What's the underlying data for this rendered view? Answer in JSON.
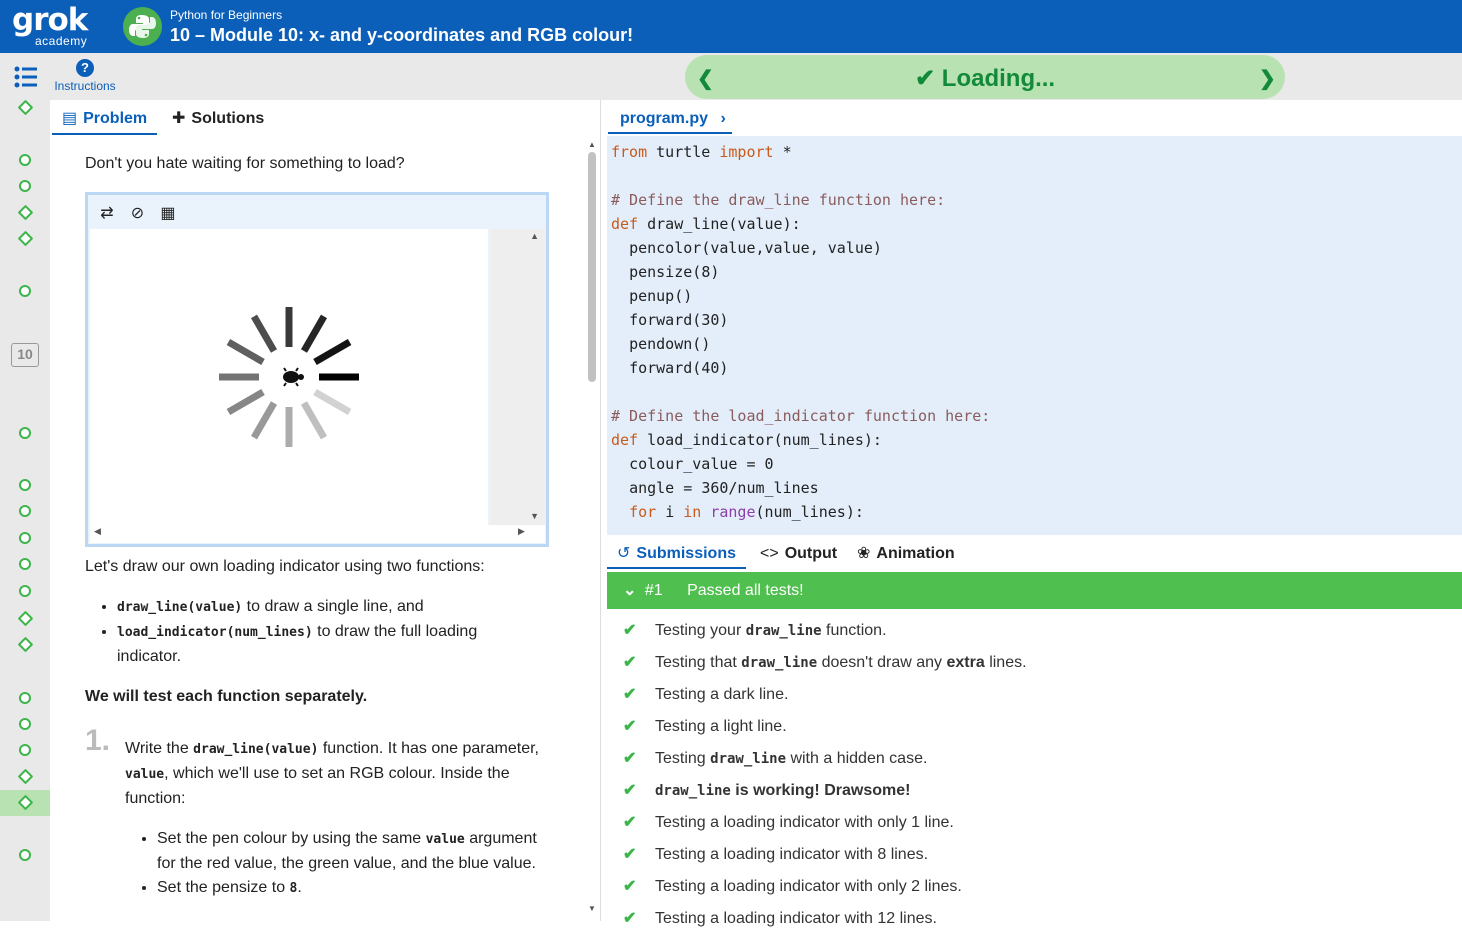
{
  "header": {
    "logo_main": "grok",
    "logo_sub": "academy",
    "course_name": "Python for Beginners",
    "module_title": "10 – Module 10: x- and y-coordinates and RGB colour!"
  },
  "toolbar": {
    "instructions_label": "Instructions",
    "loading_text": "Loading...",
    "module_badge": "10"
  },
  "left_tabs": {
    "problem": "Problem",
    "solutions": "Solutions"
  },
  "problem": {
    "intro": "Don't you hate waiting for something to load?",
    "lets_draw": "Let's draw our own loading indicator using two functions:",
    "bullet1_code": "draw_line(value)",
    "bullet1_text": " to draw a single line, and",
    "bullet2_code": "load_indicator(num_lines)",
    "bullet2_text": " to draw the full loading indicator.",
    "test_note": "We will test each function separately.",
    "step_number": "1.",
    "step1_a": "Write the ",
    "step1_code": "draw_line(value)",
    "step1_b": " function. It has one parameter, ",
    "step1_code2": "value",
    "step1_c": ", which we'll use to set an RGB colour. Inside the function:",
    "sub1_a": "Set the pen colour by using the same ",
    "sub1_code": "value",
    "sub1_b": " argument for the red value, the green value, and the blue value.",
    "sub2_a": "Set the pensize to ",
    "sub2_code": "8",
    "sub2_b": "."
  },
  "editor": {
    "file_tab": "program.py",
    "code": [
      "from turtle import *",
      "",
      "# Define the draw_line function here:",
      "def draw_line(value):",
      "  pencolor(value,value, value)",
      "  pensize(8)",
      "  penup()",
      "  forward(30)",
      "  pendown()",
      "  forward(40)",
      "",
      "# Define the load_indicator function here:",
      "def load_indicator(num_lines):",
      "  colour_value = 0",
      "  angle = 360/num_lines",
      "  for i in range(num_lines):"
    ]
  },
  "results_tabs": {
    "submissions": "Submissions",
    "output": "Output",
    "animation": "Animation"
  },
  "submission": {
    "number": "#1",
    "status": "Passed all tests!"
  },
  "tests": [
    {
      "a": "Testing your ",
      "code": "draw_line",
      "b": " function.",
      "bold": false
    },
    {
      "a": "Testing that ",
      "code": "draw_line",
      "b": " doesn't draw any ",
      "strong": "extra",
      "c": " lines.",
      "bold": false
    },
    {
      "a": "Testing a dark line.",
      "bold": false
    },
    {
      "a": "Testing a light line.",
      "bold": false
    },
    {
      "a": "Testing ",
      "code": "draw_line",
      "b": " with a hidden case.",
      "bold": false
    },
    {
      "a": "",
      "code": "draw_line",
      "b": " is working! Drawsome!",
      "bold": true
    },
    {
      "a": "Testing a loading indicator with only 1 line.",
      "bold": false
    },
    {
      "a": "Testing a loading indicator with 8 lines.",
      "bold": false
    },
    {
      "a": "Testing a loading indicator with only 2 lines.",
      "bold": false
    },
    {
      "a": "Testing a loading indicator with 12 lines.",
      "bold": false
    }
  ],
  "colors": {
    "brand_blue": "#0b5fb9",
    "success_green": "#4fc04f",
    "loading_bg": "#b9e2b2"
  }
}
